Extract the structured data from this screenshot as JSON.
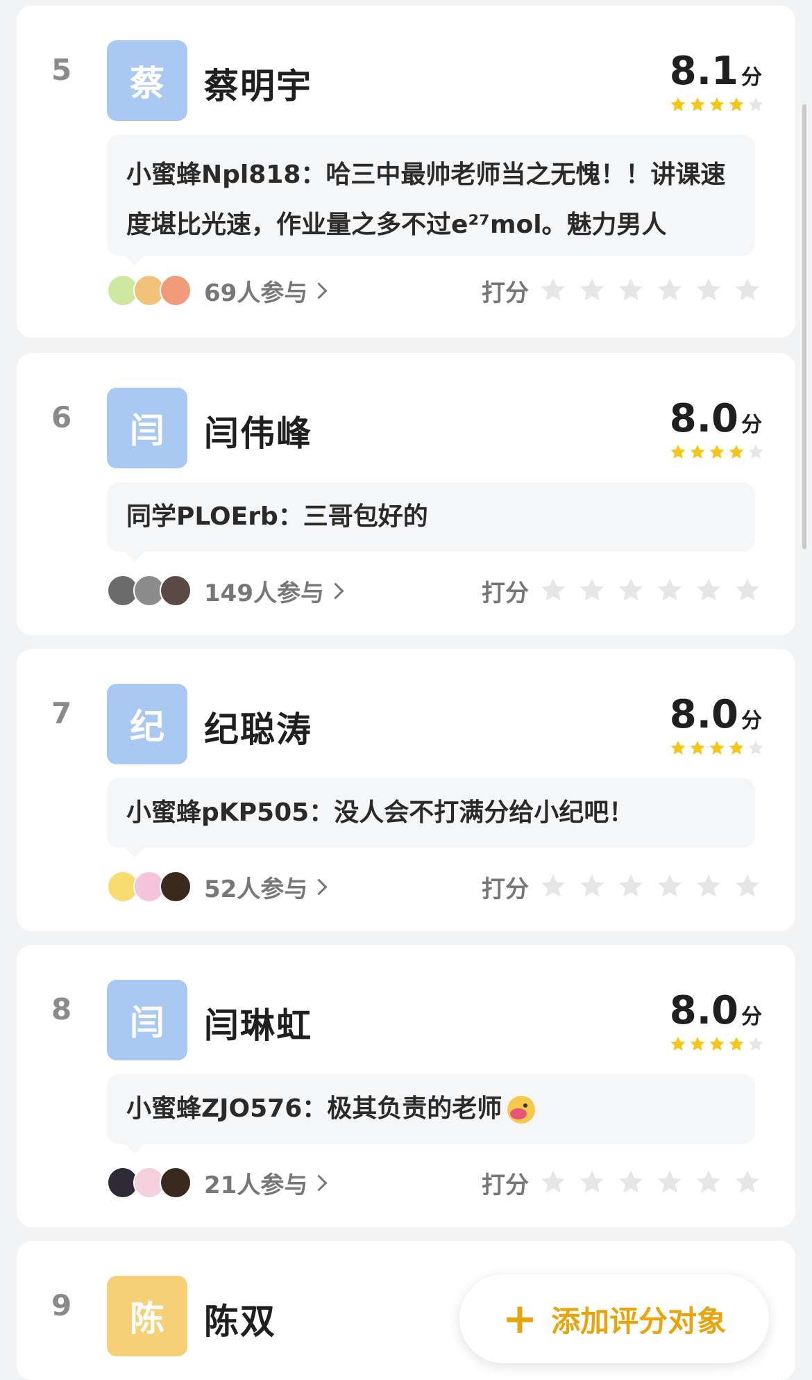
{
  "score_unit": "分",
  "rate_label": "打分",
  "colors": {
    "accent": "#e8a40c",
    "star_filled": "#f5c518",
    "star_empty": "#e6e6e6",
    "avatar_blue": "#a9c8f2",
    "avatar_yellow": "#f7cf76"
  },
  "items": [
    {
      "rank": "5",
      "avatar_char": "蔡",
      "name": "蔡明宇",
      "score": "8.1",
      "stars_filled": 4,
      "comment": "小蜜蜂Npl818：哈三中最帅老师当之无愧！！讲课速度堪比光速，作业量之多不过e²⁷mol。魅力男人",
      "participants": "69人参与"
    },
    {
      "rank": "6",
      "avatar_char": "闫",
      "name": "闫伟峰",
      "score": "8.0",
      "stars_filled": 4,
      "comment": "同学PLOErb：三哥包好的",
      "participants": "149人参与"
    },
    {
      "rank": "7",
      "avatar_char": "纪",
      "name": "纪聪涛",
      "score": "8.0",
      "stars_filled": 4,
      "comment": "小蜜蜂pKP505：没人会不打满分给小纪吧！",
      "participants": "52人参与"
    },
    {
      "rank": "8",
      "avatar_char": "闫",
      "name": "闫琳虹",
      "score": "8.0",
      "stars_filled": 4,
      "comment": "小蜜蜂ZJO576：极其负责的老师",
      "participants": "21人参与"
    },
    {
      "rank": "9",
      "avatar_char": "陈",
      "name": "陈双"
    }
  ],
  "add_button": {
    "label": "添加评分对象"
  }
}
